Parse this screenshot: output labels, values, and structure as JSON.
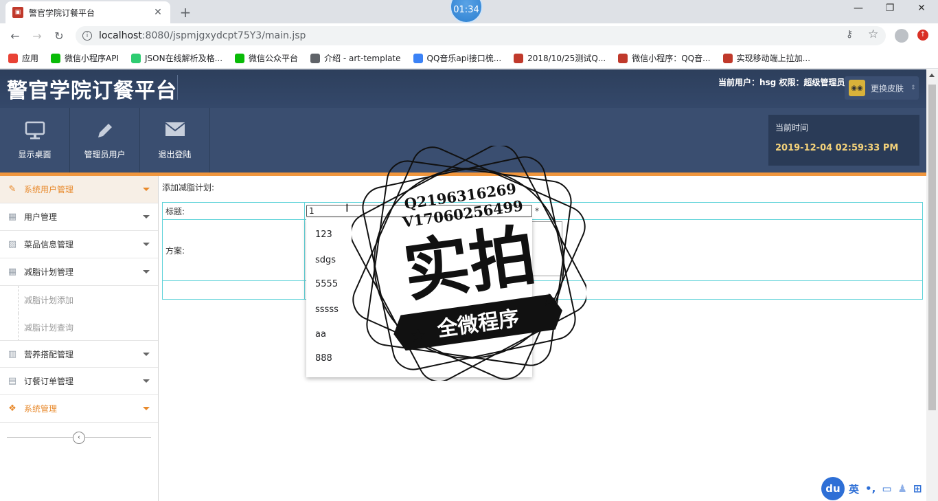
{
  "browser": {
    "tab_title": "警官学院订餐平台",
    "timer": "01:34",
    "url_host": "localhost",
    "url_rest": ":8080/jspmjgxydcpt75Y3/main.jsp",
    "bookmarks": [
      {
        "label": "应用",
        "color": "#e94235"
      },
      {
        "label": "微信小程序API",
        "color": "#09bb07"
      },
      {
        "label": "JSON在线解析及格...",
        "color": "#2ecc71"
      },
      {
        "label": "微信公众平台",
        "color": "#09bb07"
      },
      {
        "label": "介绍 - art-template",
        "color": "#5f6368"
      },
      {
        "label": "QQ音乐api接口梳...",
        "color": "#3b82f6"
      },
      {
        "label": "2018/10/25测试Q...",
        "color": "#c0392b"
      },
      {
        "label": "微信小程序：QQ音...",
        "color": "#c0392b"
      },
      {
        "label": "实现移动端上拉加...",
        "color": "#c0392b"
      }
    ]
  },
  "header": {
    "title": "警官学院订餐平台",
    "user_info": "当前用户：hsg  权限：超级管理员",
    "skin_label": "更换皮肤"
  },
  "nav": {
    "items": [
      {
        "label": "显示桌面",
        "icon": "monitor-icon"
      },
      {
        "label": "管理员用户",
        "icon": "pencil-icon"
      },
      {
        "label": "退出登陆",
        "icon": "envelope-icon"
      }
    ],
    "time_label": "当前时间",
    "time_value": "2019-12-04 02:59:33 PM"
  },
  "sidebar": {
    "items": [
      {
        "label": "系统用户管理",
        "icon": "pencil-icon"
      },
      {
        "label": "用户管理",
        "icon": "grid-icon"
      },
      {
        "label": "菜品信息管理",
        "icon": "image-icon"
      },
      {
        "label": "减脂计划管理",
        "icon": "grid-icon"
      },
      {
        "label": "营养搭配管理",
        "icon": "layout-icon"
      },
      {
        "label": "订餐订单管理",
        "icon": "calendar-icon"
      },
      {
        "label": "系统管理",
        "icon": "dropbox-icon"
      }
    ],
    "subitems": [
      "减脂计划添加",
      "减脂计划查询"
    ]
  },
  "content": {
    "breadcrumb": "添加减脂计划:",
    "title_label": "标题:",
    "plan_label": "方案:",
    "title_value": "1",
    "required_mark": "*",
    "suggestions": [
      "123",
      "sdgs",
      "5555",
      "sssss",
      "aa",
      "888"
    ]
  },
  "stamp": {
    "line1": "Q2196316269",
    "line2": "V17060256499",
    "big": "实拍",
    "banner": "全微程序"
  },
  "ime": {
    "logo": "du",
    "lang": "英",
    "punct": "•,"
  }
}
